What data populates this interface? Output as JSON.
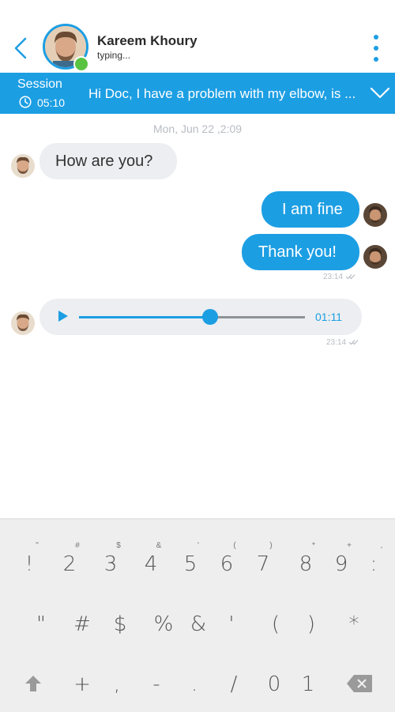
{
  "header": {
    "contact_name": "Kareem Khoury",
    "status": "typing...",
    "accent": "#1c9ee3",
    "online_color": "#5ac341"
  },
  "session": {
    "label": "Session",
    "time": "05:10",
    "preview": "Hi Doc, I have a problem with my elbow, is ..."
  },
  "chat": {
    "date": "Mon, Jun 22 ,2:09",
    "messages": [
      {
        "from": "contact",
        "text": "How are you?"
      },
      {
        "from": "me",
        "text": "I am fine"
      },
      {
        "from": "me",
        "text": "Thank you!",
        "time": "23:14"
      }
    ],
    "audio": {
      "duration": "01:11",
      "progress": 0.58,
      "time": "23:14"
    }
  },
  "keyboard": {
    "row1": [
      {
        "key": "!",
        "hint": "\""
      },
      {
        "key": "2",
        "hint": "#"
      },
      {
        "key": "3",
        "hint": "$"
      },
      {
        "key": "4",
        "hint": "&"
      },
      {
        "key": "5",
        "hint": "'"
      },
      {
        "key": "6",
        "hint": "("
      },
      {
        "key": "7",
        "hint": ")"
      },
      {
        "key": "8",
        "hint": "*"
      },
      {
        "key": "9",
        "hint": "+"
      },
      {
        "key": ":",
        "hint": ","
      }
    ],
    "row2": [
      "\"",
      "#",
      "$",
      "%",
      "&",
      "'",
      "(",
      ")",
      "*"
    ],
    "row3": [
      "+",
      ",",
      "-",
      ".",
      "/",
      "0",
      "1"
    ]
  },
  "icons": [
    "back-chevron-icon",
    "more-vertical-icon",
    "clock-icon",
    "chevron-down-icon",
    "play-icon",
    "shift-icon",
    "backspace-icon",
    "double-check-icon"
  ]
}
